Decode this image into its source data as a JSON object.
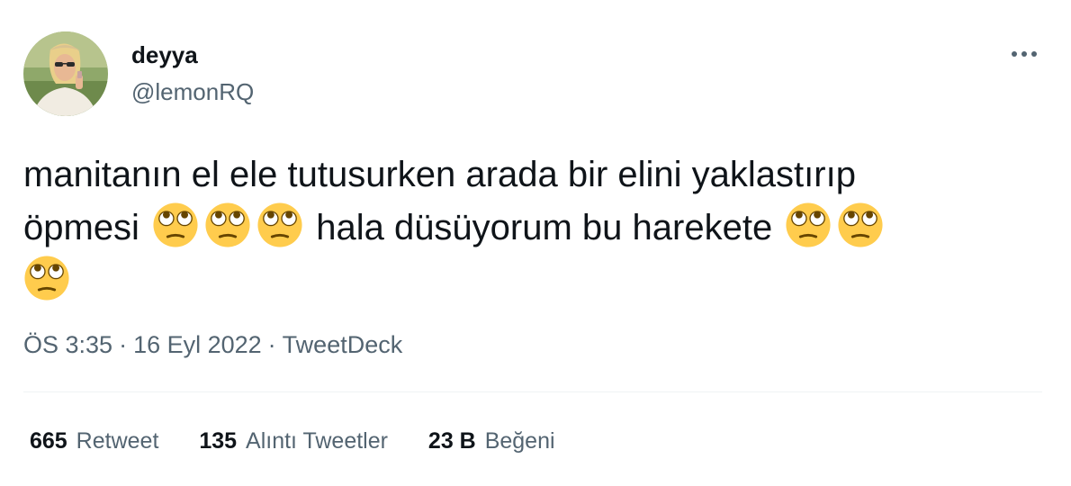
{
  "author": {
    "display_name": "deyya",
    "handle": "@lemonRQ",
    "avatar_icon": "profile-photo"
  },
  "more_icon": "ellipsis-icon",
  "tweet": {
    "line1": "manitanın el ele tutusurken arada bir elini yaklastırıp",
    "line2_text": "öpmesi",
    "line2_mid": "hala düsüyorum bu harekete",
    "emoji_name": "face-with-rolling-eyes-emoji",
    "emoji_count": 6
  },
  "meta": {
    "time": "ÖS 3:35",
    "separator": "·",
    "date": "16 Eyl 2022",
    "source": "TweetDeck"
  },
  "stats": {
    "retweets_count": "665",
    "retweets_label": "Retweet",
    "quotes_count": "135",
    "quotes_label": "Alıntı Tweetler",
    "likes_count": "23 B",
    "likes_label": "Beğeni"
  },
  "colors": {
    "text_primary": "#0f1419",
    "text_secondary": "#536471",
    "divider": "#eff3f4",
    "emoji_face": "#ffcc4d"
  }
}
